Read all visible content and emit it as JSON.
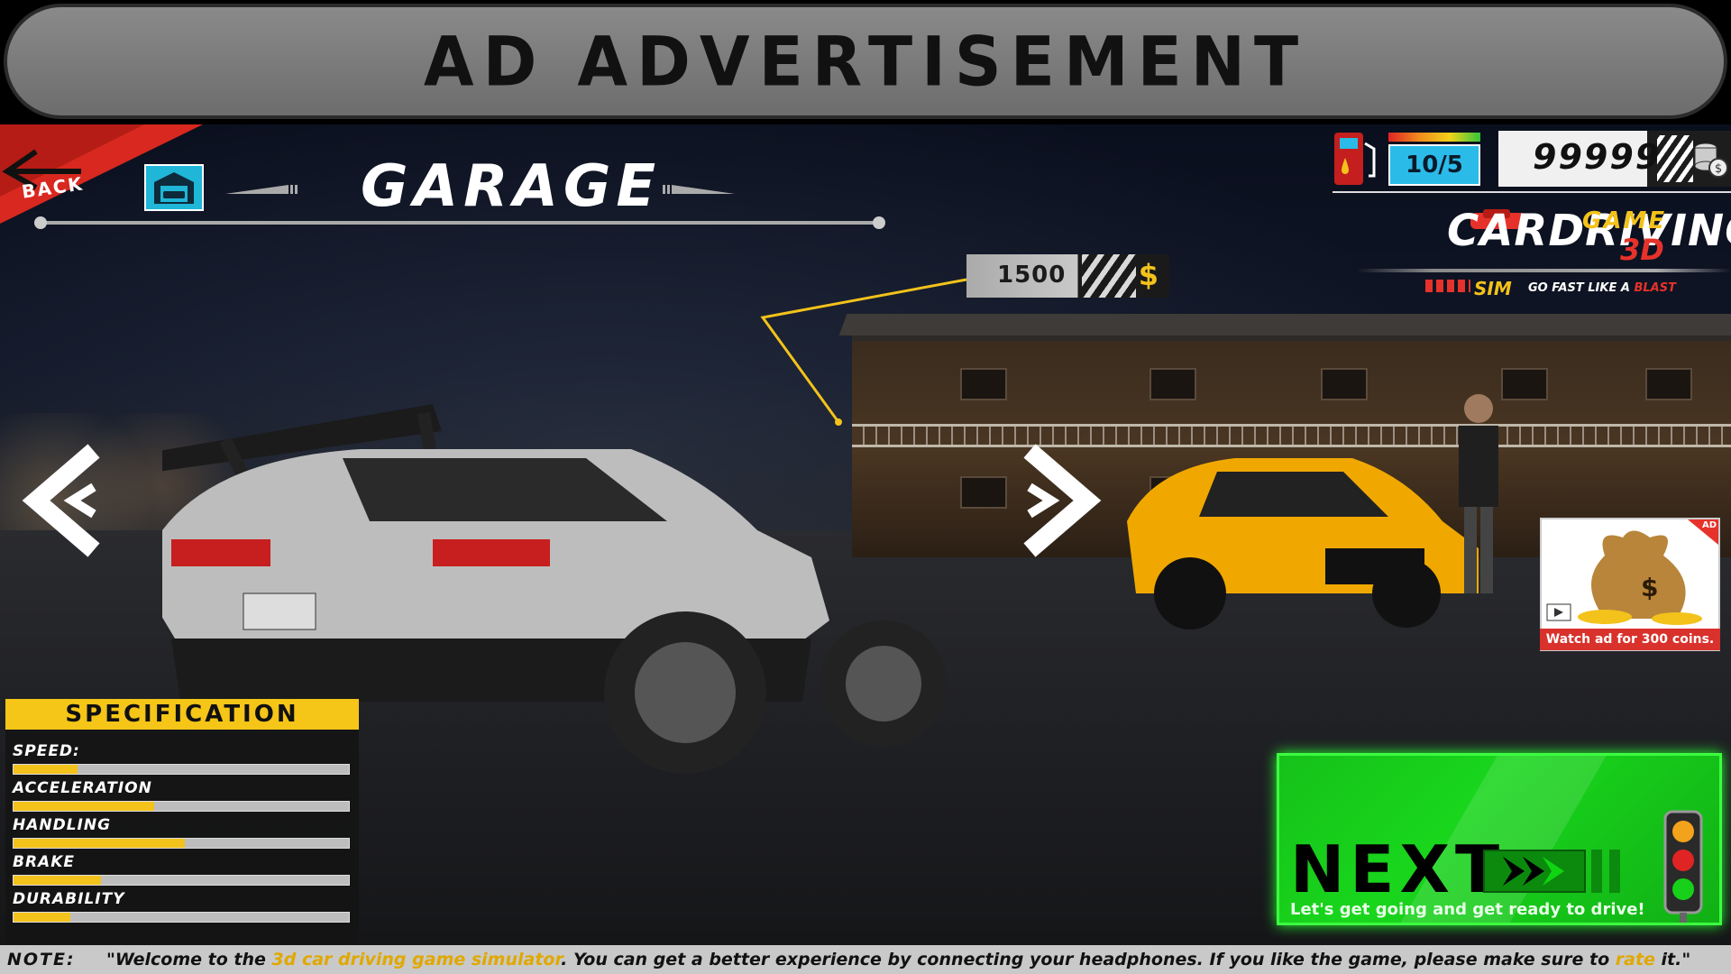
{
  "ad_banner": {
    "text": "AD ADVERTISEMENT"
  },
  "header": {
    "back_label": "BACK",
    "title": "GARAGE"
  },
  "price": {
    "value": "1500",
    "currency_icon": "dollar-icon"
  },
  "hud": {
    "fuel_count": "10/5",
    "coins": "99999"
  },
  "logo": {
    "car_driving": "CARDRIVING",
    "game": "GAME",
    "three_d": "3D",
    "sim": "SIM",
    "tagline_prefix": "GO FAST LIKE A",
    "tagline_highlight": "BLAST"
  },
  "ad_reward": {
    "badge": "AD",
    "caption": "Watch ad for 300 coins."
  },
  "specification": {
    "title": "SPECIFICATION",
    "stats": [
      {
        "label": "SPEED:",
        "value": 0.19
      },
      {
        "label": "ACCELERATION",
        "value": 0.42
      },
      {
        "label": "HANDLING",
        "value": 0.51
      },
      {
        "label": "BRAKE",
        "value": 0.26
      },
      {
        "label": "DURABILITY",
        "value": 0.17
      }
    ]
  },
  "next": {
    "label": "NEXT",
    "subtitle": "Let's get going and get ready to drive!"
  },
  "note": {
    "label": "NOTE:",
    "text_1": "\"Welcome to the ",
    "highlight_1": "3d car driving game simulator",
    "text_2": ". You can get a better experience by connecting your headphones. If you like the game, please make sure to ",
    "highlight_2": "rate",
    "text_3": " it.\""
  },
  "colors": {
    "accent_yellow": "#f3c21b",
    "next_green": "#19d61c",
    "back_red": "#e6322a",
    "hud_blue": "#2bbbe8"
  }
}
